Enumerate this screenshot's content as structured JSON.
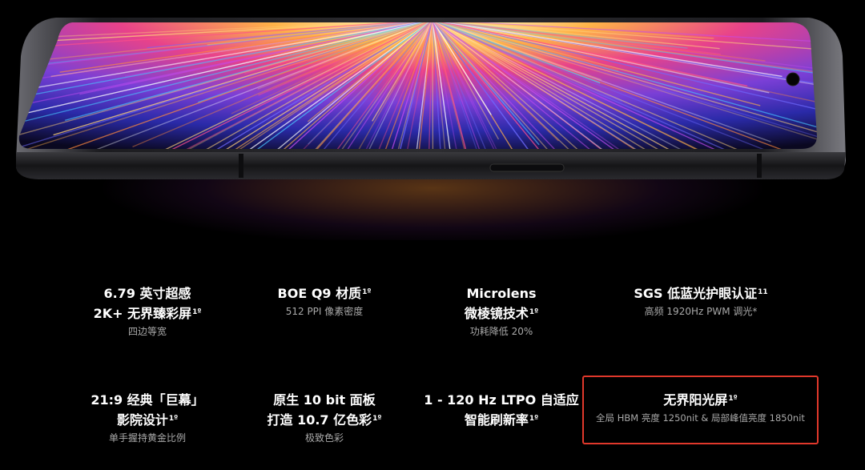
{
  "hero": {
    "image_icon": "phone-display-icon"
  },
  "specs": [
    {
      "line1": "6.79 英寸超感",
      "line2": "2K+ 无界臻彩屏",
      "line2_sup": "1º",
      "sub": "四边等宽"
    },
    {
      "line1": "BOE Q9 材质",
      "line1_sup": "1º",
      "sub": "512 PPI 像素密度"
    },
    {
      "line1": "Microlens",
      "line2": "微棱镜技术",
      "line2_sup": "1º",
      "sub": "功耗降低 20%"
    },
    {
      "line1": "SGS 低蓝光护眼认证",
      "line1_sup": "11",
      "sub": "高频 1920Hz PWM 调光*"
    },
    {
      "line1": "21:9 经典「巨幕」",
      "line2": "影院设计",
      "line2_sup": "1º",
      "sub": "单手握持黄金比例"
    },
    {
      "line1": "原生 10 bit 面板",
      "line2": "打造 10.7 亿色彩",
      "line2_sup": "1º",
      "sub": "极致色彩"
    },
    {
      "line1": "1 - 120 Hz LTPO 自适应",
      "line2": "智能刷新率",
      "line2_sup": "1º"
    },
    {
      "line1": "无界阳光屏",
      "line1_sup": "1º",
      "sub": "全局 HBM 亮度 1250nit & 局部峰值亮度 1850nit"
    }
  ],
  "colors": {
    "background": "#000000",
    "subtext": "#a9a9a9",
    "highlight_border": "#e0382b"
  }
}
